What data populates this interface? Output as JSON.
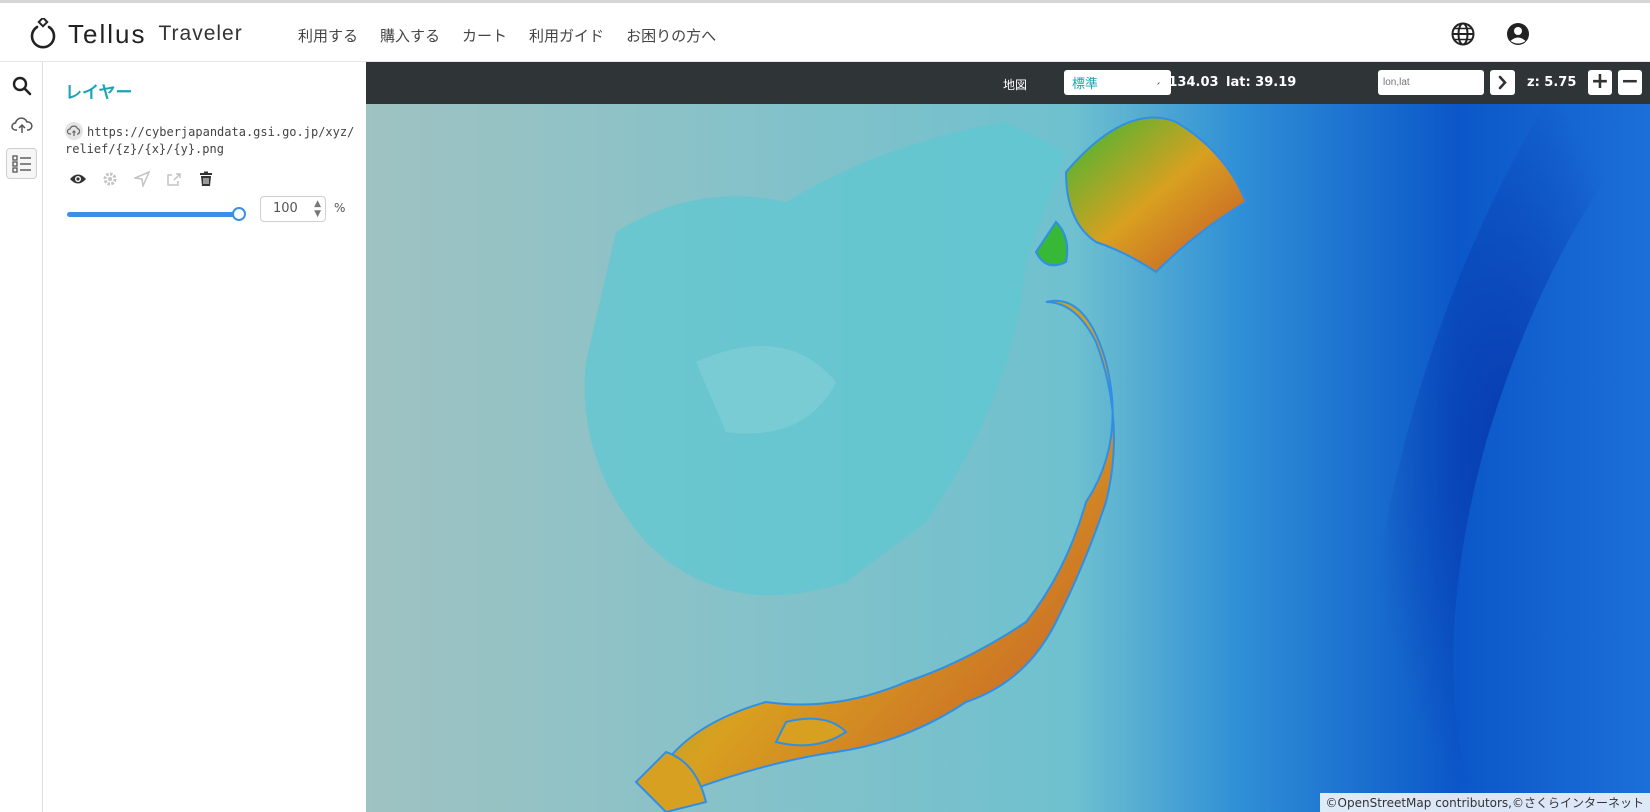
{
  "app": {
    "logo_word": "Tellus",
    "logo_sub": "Traveler"
  },
  "nav": {
    "items": [
      "利用する",
      "購入する",
      "カート",
      "利用ガイド",
      "お困りの方へ"
    ]
  },
  "header_icons": [
    "globe-icon",
    "user-account-icon"
  ],
  "rail": {
    "items": [
      "search-icon",
      "cloud-upload-icon",
      "layer-list-icon"
    ],
    "active": "layer-list-icon"
  },
  "panel": {
    "title": "レイヤー",
    "layer": {
      "url": "https://cyberjapandata.gsi.go.jp/xyz/relief/{z}/{x}/{y}.png",
      "opacity": "100",
      "opacity_unit": "%",
      "slider_fraction": 1.0,
      "tools": [
        "eye-icon",
        "gear-icon",
        "locate-icon",
        "share-icon",
        "trash-icon"
      ]
    }
  },
  "mapbar": {
    "map_label": "地図",
    "map_select": "標準",
    "lon": "lon: 134.03",
    "lat": "lat: 39.19",
    "lonlat_placeholder": "lon,lat",
    "zoom": "z: 5.75",
    "zoom_in": "+",
    "zoom_out": "−"
  },
  "attribution": "©OpenStreetMap contributors,©さくらインターネット",
  "colors": {
    "accent": "#1aa3b8",
    "slider": "#3d8fe6",
    "mapbar": "#2f3437"
  }
}
